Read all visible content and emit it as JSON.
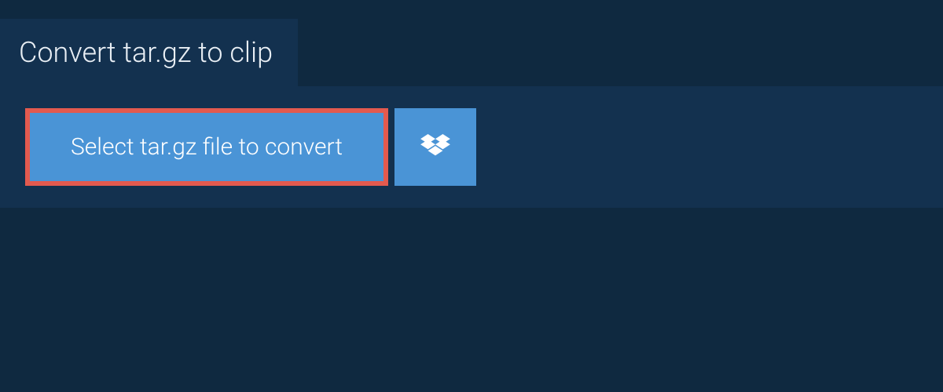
{
  "tab": {
    "title": "Convert tar.gz to clip"
  },
  "actions": {
    "select_file_label": "Select tar.gz file to convert"
  }
}
